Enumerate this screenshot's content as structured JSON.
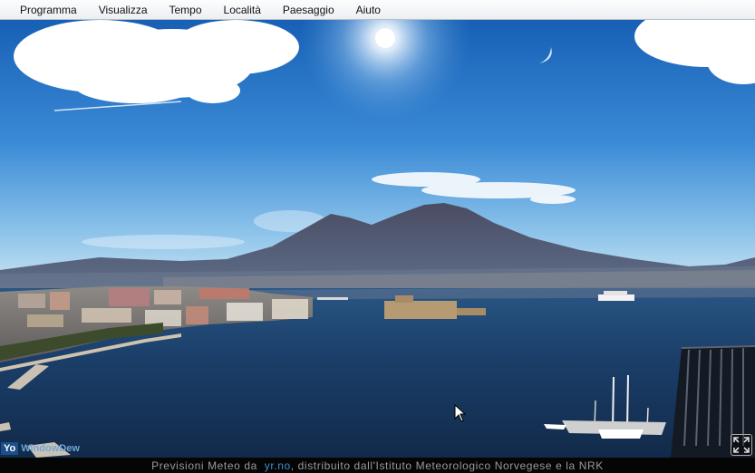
{
  "menu": {
    "items": [
      {
        "label": "Programma"
      },
      {
        "label": "Visualizza"
      },
      {
        "label": "Tempo"
      },
      {
        "label": "Località"
      },
      {
        "label": "Paesaggio"
      },
      {
        "label": "Aiuto"
      }
    ]
  },
  "footer": {
    "prefix": "Previsioni Meteo da  ",
    "link": "yr.no",
    "suffix": ", distribuito dall'Istituto Meteorologico Norvegese e la NRK"
  },
  "brand": {
    "part1": "Yo",
    "part2": "WindowDew"
  },
  "colors": {
    "sky_top": "#1863b8",
    "sky_horizon": "#bfe0f0",
    "sea": "#16355e",
    "link": "#3c8fd0"
  },
  "icons": {
    "fullscreen": "expand-arrows-icon",
    "cursor": "mouse-pointer-icon"
  }
}
